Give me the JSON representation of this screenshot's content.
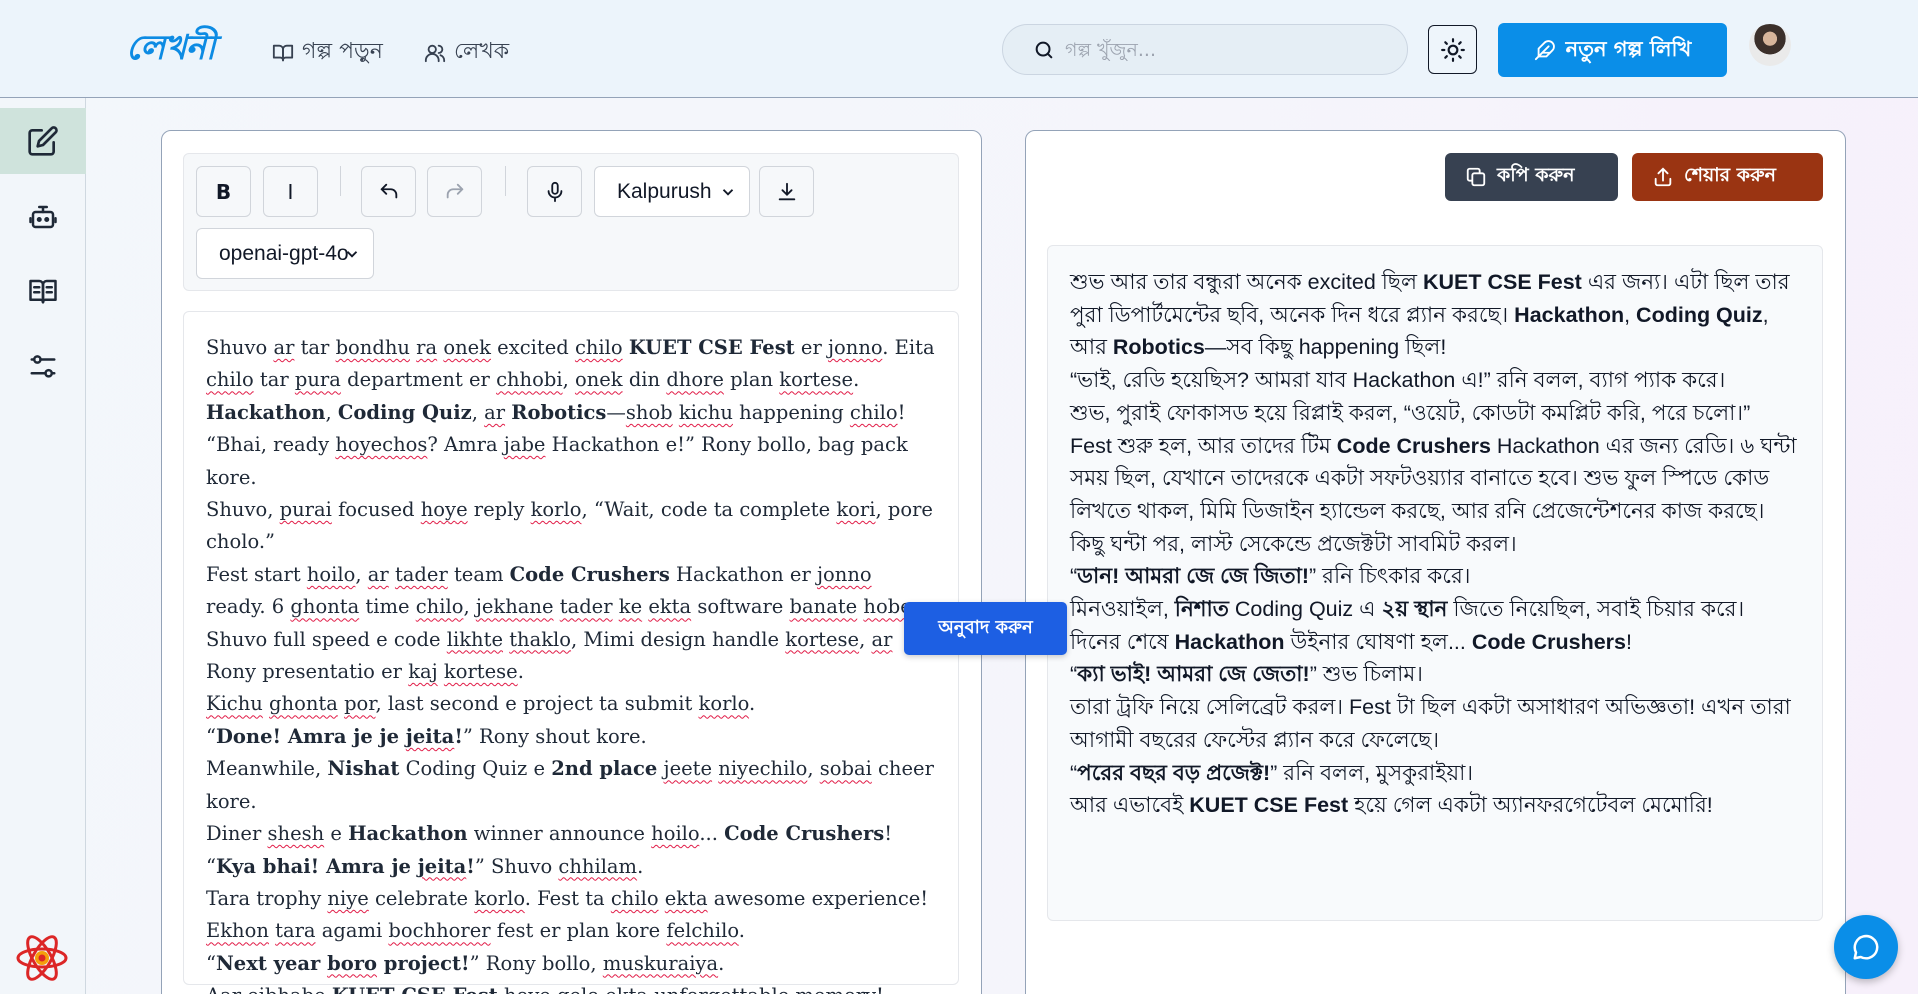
{
  "header": {
    "logo": "লেখনী",
    "nav": [
      {
        "label": "গল্প পড়ুন",
        "icon": "book-open-icon"
      },
      {
        "label": "লেখক",
        "icon": "users-icon"
      }
    ],
    "search_placeholder": "গল্প খুঁজুন...",
    "new_story_label": "নতুন গল্প লিখি"
  },
  "sidebar": {
    "items": [
      {
        "icon": "edit-icon",
        "active": true
      },
      {
        "icon": "bot-icon",
        "active": false
      },
      {
        "icon": "book-icon",
        "active": false
      },
      {
        "icon": "sliders-icon",
        "active": false
      }
    ]
  },
  "toolbar": {
    "bold": "B",
    "italic": "I",
    "font_select": "Kalpurush",
    "model_select": "openai-gpt-4o"
  },
  "translate_label": "অনুবাদ করুন",
  "actions": {
    "copy_label": "কপি করুন",
    "share_label": "শেয়ার করুন"
  },
  "colors": {
    "brand": "#0a8ee8",
    "translate": "#1d5fe3",
    "copy": "#374151",
    "share": "#9a3412"
  }
}
